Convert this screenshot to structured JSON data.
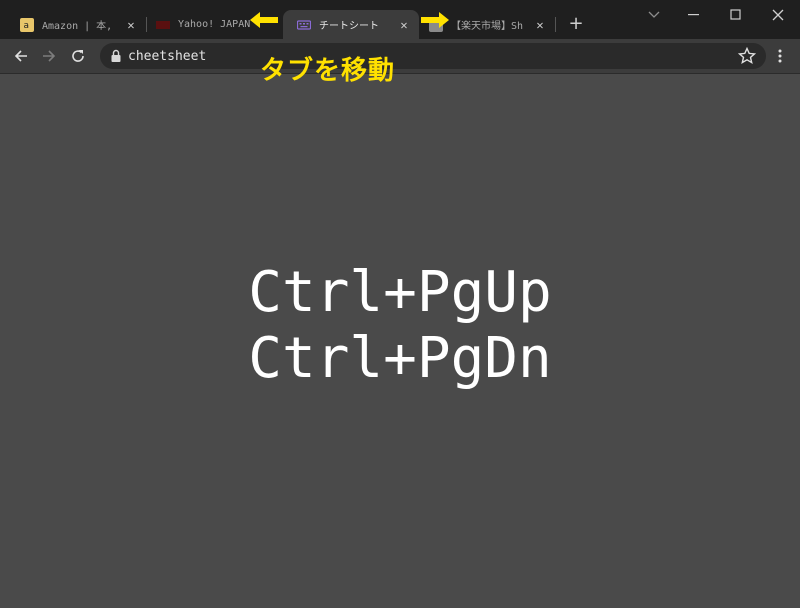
{
  "tabs": [
    {
      "label": "Amazon | 本, ",
      "icon": "amazon-favicon-icon",
      "active": false
    },
    {
      "label": "Yahoo! JAPAN",
      "icon": "yahoo-favicon-icon",
      "active": false
    },
    {
      "label": "チートシート",
      "icon": "keyboard-favicon-icon",
      "active": true
    },
    {
      "label": "【楽天市場】Sh",
      "icon": "rakuten-favicon-icon",
      "active": false
    }
  ],
  "new_tab_label": "+",
  "window_controls": {
    "minimize": "—",
    "maximize": "☐",
    "close": "✕",
    "dropdown": "⌄"
  },
  "address_bar": {
    "url": "cheetsheet"
  },
  "annotation": {
    "label": "タブを移動",
    "color": "#ffe100"
  },
  "shortcuts": [
    "Ctrl+PgUp",
    "Ctrl+PgDn"
  ],
  "colors": {
    "page_bg": "#4a4a4a",
    "titlebar_bg": "#1f1f1f",
    "toolbar_bg": "#3c3c3c",
    "annotation": "#ffe100"
  }
}
